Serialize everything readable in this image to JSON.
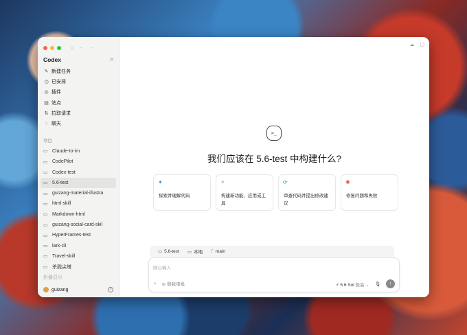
{
  "app": {
    "title": "Codex"
  },
  "nav": [
    {
      "label": "新建任务",
      "icon": "new-task-icon",
      "glyph": "✎"
    },
    {
      "label": "已安排",
      "icon": "clock-icon",
      "glyph": "◷"
    },
    {
      "label": "插件",
      "icon": "plugin-icon",
      "glyph": "◎"
    },
    {
      "label": "站点",
      "icon": "site-icon",
      "glyph": "▤"
    },
    {
      "label": "拉取请求",
      "icon": "pull-request-icon",
      "glyph": "⇅"
    },
    {
      "label": "聊天",
      "icon": "chat-icon",
      "glyph": "◌"
    }
  ],
  "projects": {
    "label": "项目",
    "items": [
      "Claude-to-im",
      "CodePilot",
      "Codex-test",
      "5.6-test",
      "guizang-material-illustra",
      "html-skill",
      "Markdown-html",
      "guizang-social-card-skil",
      "HyperFrames-test",
      "lark-cli",
      "Travel-skill",
      "杀戮尖塔"
    ],
    "more": "折叠显示"
  },
  "user": {
    "name": "guizang"
  },
  "main": {
    "headline": "我们应该在 5.6-test 中构建什么?",
    "cards": [
      {
        "text": "探索并理解代码",
        "icon": "explore-icon",
        "glyph": "✦",
        "color": "#3a8ee6"
      },
      {
        "text": "构建新功能、应用或工具",
        "icon": "build-icon",
        "glyph": "✧",
        "color": "#9b59d0"
      },
      {
        "text": "审查代码并提出修改建议",
        "icon": "review-icon",
        "glyph": "⟳",
        "color": "#2fa84f"
      },
      {
        "text": "修复问题和失败",
        "icon": "fix-icon",
        "glyph": "✺",
        "color": "#e0532e"
      }
    ],
    "context": {
      "project": "5.6-test",
      "location": "本地",
      "branch": "main"
    },
    "composer": {
      "placeholder": "随心输入",
      "mode": "替我审批",
      "model": "5.6 Sol",
      "effort": "极高"
    }
  }
}
